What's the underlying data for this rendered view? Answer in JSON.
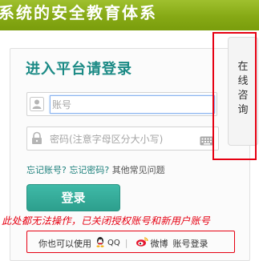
{
  "banner": {
    "title": "系统的安全教育体系"
  },
  "login": {
    "heading": "进入平台请登录",
    "username_placeholder": "账号",
    "password_placeholder": "密码(注意字母区分大小写)",
    "forgot_account": "忘记账号?",
    "forgot_password": "忘记密码?",
    "faq": "其他常见问题",
    "submit_label": "登录"
  },
  "warning": {
    "text": "此处都无法操作，已关闭授权账号和新用户账号"
  },
  "third_party": {
    "prefix": "你也可以使用",
    "qq_label": "QQ",
    "separator": "|",
    "weibo_label": "微博",
    "account_login": "账号登录"
  },
  "consult": {
    "chars": [
      "在",
      "线",
      "咨",
      "询"
    ]
  },
  "colors": {
    "accent": "#1b8a85",
    "warning": "#e60012",
    "banner": "#8ab11d"
  },
  "icons": {
    "user": "user-icon",
    "lock": "lock-icon",
    "keyboard": "keyboard-icon",
    "qq": "qq-icon",
    "weibo": "weibo-icon"
  }
}
